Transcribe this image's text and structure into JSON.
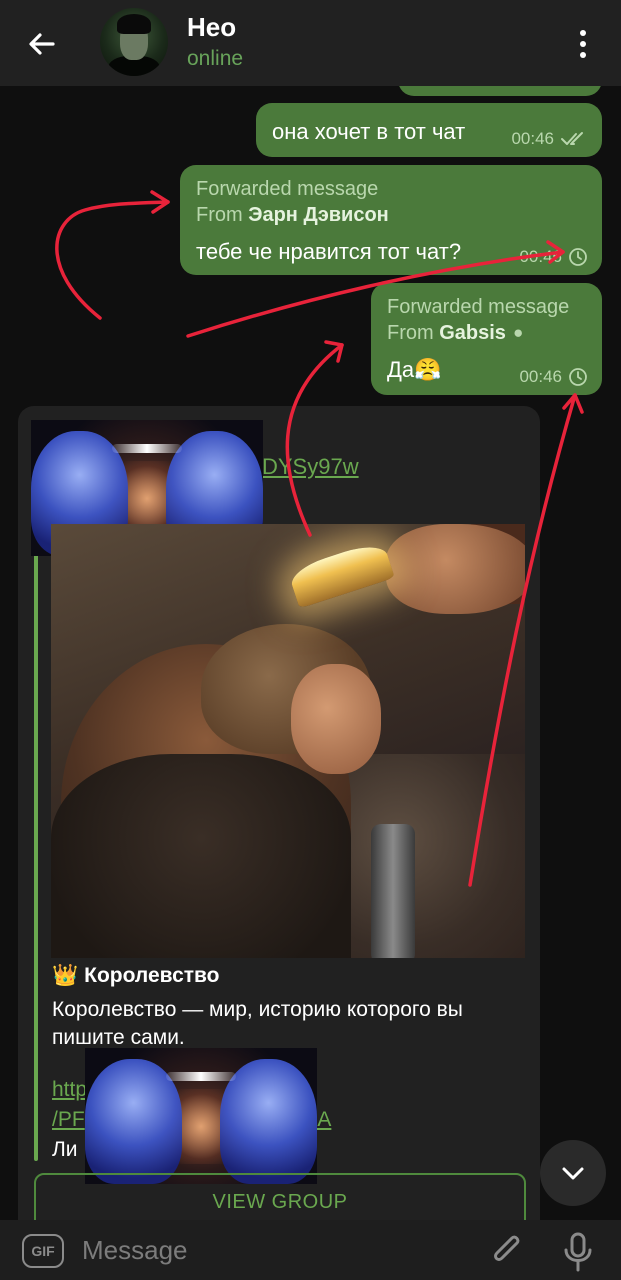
{
  "header": {
    "back_icon": "arrow-left-icon",
    "title": "Нео",
    "status": "online",
    "menu_icon": "more-vert-icon"
  },
  "messages": [
    {
      "text": "она хочет в тот чат",
      "time": "00:46",
      "status_icon": "double-check-icon"
    },
    {
      "forwarded_label": "Forwarded message",
      "from_prefix": "From",
      "from_name": "Эарн Дэвисон",
      "text": "тебе че нравится тот чат?",
      "time": "00:46",
      "status_icon": "clock-icon"
    },
    {
      "forwarded_label": "Forwarded message",
      "from_prefix": "From",
      "from_name": "Gabsis",
      "from_emoji": "⚫",
      "text": "Да😤",
      "time": "00:46",
      "status_icon": "clock-icon"
    }
  ],
  "post": {
    "link_top": "DYSy97w",
    "title_emoji": "👑",
    "title": "Королевство",
    "body": "Королевство — мир, историю которого вы пишите сами.",
    "link_line1": "http",
    "link_line2": "/PF",
    "link_line2_end": "95A",
    "cut_text": "Ли",
    "button": "VIEW GROUP"
  },
  "input": {
    "gif_label": "GIF",
    "placeholder": "Message",
    "attach_icon": "paperclip-icon",
    "mic_icon": "microphone-icon"
  },
  "colors": {
    "header_bg": "#212121",
    "outgoing_bubble": "#4b7a3b",
    "accent_green": "#6aa84f",
    "annotation_red": "#e8233a"
  }
}
